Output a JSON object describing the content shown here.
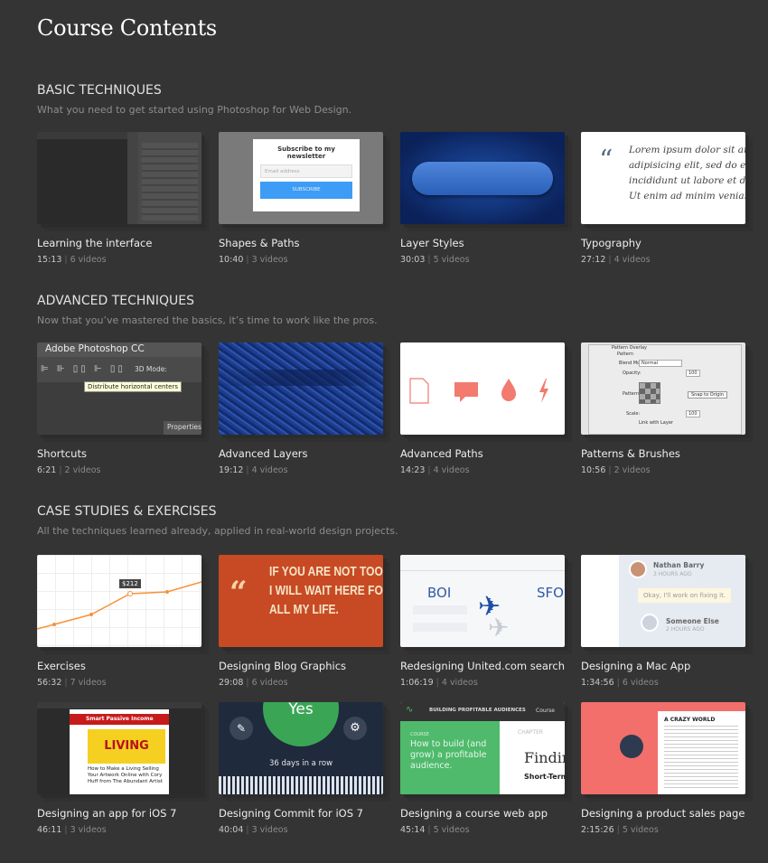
{
  "title": "Course Contents",
  "sections": [
    {
      "heading": "BASIC TECHNIQUES",
      "subtitle": "What you need to get started using Photoshop for Web Design.",
      "courses": [
        {
          "title": "Learning the interface",
          "duration": "15:13",
          "videos": "6 videos"
        },
        {
          "title": "Shapes & Paths",
          "duration": "10:40",
          "videos": "3 videos"
        },
        {
          "title": "Layer Styles",
          "duration": "30:03",
          "videos": "5 videos"
        },
        {
          "title": "Typography",
          "duration": "27:12",
          "videos": "4 videos"
        }
      ]
    },
    {
      "heading": "ADVANCED TECHNIQUES",
      "subtitle": "Now that you’ve mastered the basics, it’s time to work like the pros.",
      "courses": [
        {
          "title": "Shortcuts",
          "duration": "6:21",
          "videos": "2 videos"
        },
        {
          "title": "Advanced Layers",
          "duration": "19:12",
          "videos": "4 videos"
        },
        {
          "title": "Advanced Paths",
          "duration": "14:23",
          "videos": "4 videos"
        },
        {
          "title": "Patterns & Brushes",
          "duration": "10:56",
          "videos": "2 videos"
        }
      ]
    },
    {
      "heading": "CASE STUDIES & EXERCISES",
      "subtitle": "All the techniques learned already, applied in real-world design projects.",
      "courses": [
        {
          "title": "Exercises",
          "duration": "56:32",
          "videos": "7 videos"
        },
        {
          "title": "Designing Blog Graphics",
          "duration": "29:08",
          "videos": "6 videos"
        },
        {
          "title": "Redesigning United.com search",
          "duration": "1:06:19",
          "videos": "4 videos"
        },
        {
          "title": "Designing a Mac App",
          "duration": "1:34:56",
          "videos": "6 videos"
        },
        {
          "title": "Designing an app for iOS 7",
          "duration": "46:11",
          "videos": "3 videos"
        },
        {
          "title": "Designing Commit for iOS 7",
          "duration": "40:04",
          "videos": "3 videos"
        },
        {
          "title": "Designing a course web app",
          "duration": "45:14",
          "videos": "5 videos"
        },
        {
          "title": "Designing a product sales page",
          "duration": "2:15:26",
          "videos": "5 videos"
        }
      ]
    }
  ],
  "thumbs": {
    "shapes": {
      "heading": "Subscribe to my newsletter",
      "placeholder": "Email address",
      "button": "SUBSCRIBE"
    },
    "typography": {
      "quote": "“",
      "lines": [
        "Lorem ipsum dolor sit am",
        "adipisicing elit, sed do eiu",
        "incididunt ut labore et dolo",
        "Ut enim ad minim veniam"
      ]
    },
    "shortcuts": {
      "app": "Adobe Photoshop CC",
      "mode": "3D Mode:",
      "tooltip": "Distribute horizontal centers",
      "panel": "Properties"
    },
    "patterns": {
      "title": "Pattern Overlay",
      "group": "Pattern",
      "blend": "Blend Mode:",
      "blend_value": "Normal",
      "opacity": "Opacity:",
      "opacity_value": "100",
      "pattern": "Pattern:",
      "snap": "Snap to Origin",
      "scale": "Scale:",
      "scale_value": "100",
      "link": "Link with Layer"
    },
    "exercises": {
      "label": "$212"
    },
    "blog": {
      "lines": [
        "IF YOU ARE NOT TOO LO",
        "I WILL WAIT HERE FOR",
        "ALL MY LIFE."
      ]
    },
    "united": {
      "from": "BOI",
      "to": "SFO"
    },
    "mac": {
      "name1": "Nathan Barry",
      "time1": "3 HOURS AGO",
      "message": "Okay, I'll work on fixing it.",
      "name2": "Someone Else",
      "time2": "2 HOURS AGO"
    },
    "ios": {
      "bar": "Smart Passive Income",
      "banner": "LIVING",
      "caption": "How to Make a Living Selling Your Artwork Online with Cory Huff from The Abundant Artist"
    },
    "commit": {
      "yes": "Yes",
      "streak": "36 days in a row"
    },
    "webapp": {
      "brand": "BUILDING PROFITABLE AUDIENCES",
      "course": "Course",
      "label": "COURSE",
      "headline": "How to build (and grow) a profitable audience.",
      "chapter": "CHAPTER",
      "heading": "Findin",
      "sub": "Short-Term Cas"
    },
    "sales": {
      "heading": "A CRAZY WORLD"
    }
  }
}
